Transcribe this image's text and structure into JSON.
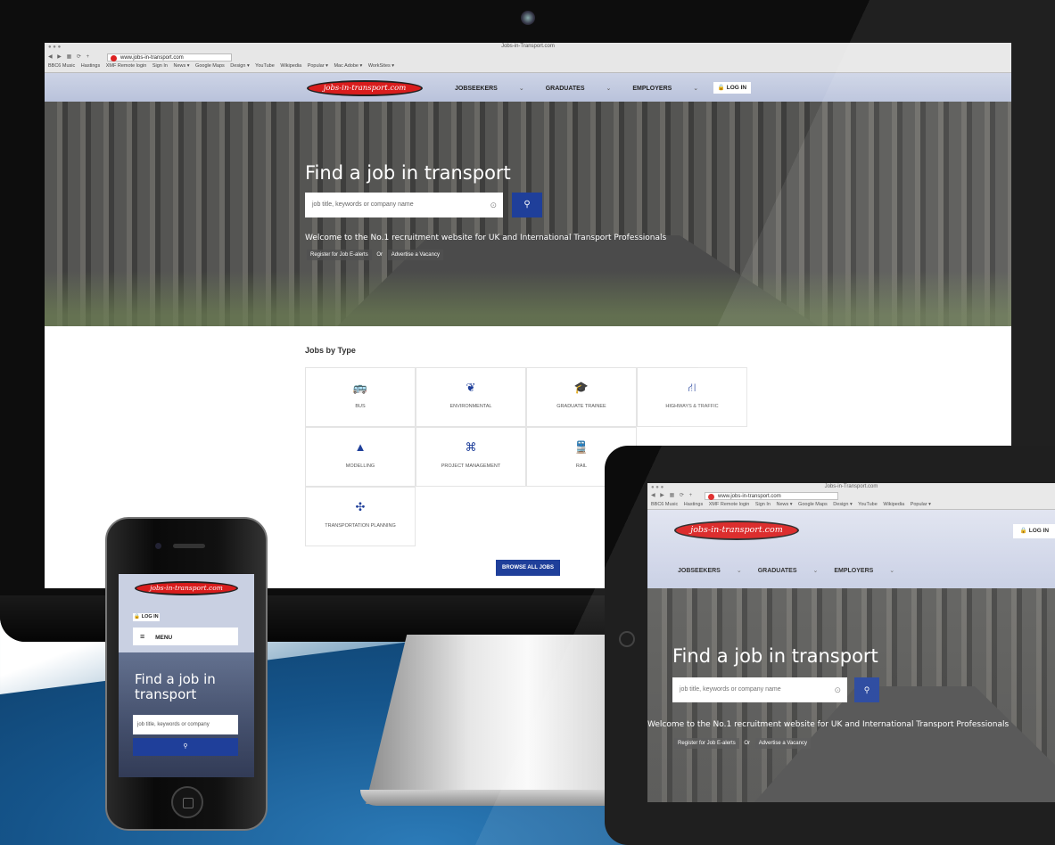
{
  "colors": {
    "brand_blue": "#1f3f9a",
    "logo_red": "#d91c1c"
  },
  "browser": {
    "title": "Jobs-in-Transport.com",
    "url": "www.jobs-in-transport.com",
    "nav_buttons": "◀ ▶ ▦ ⟳ +",
    "bookmarks": [
      "BBC6 Music",
      "Hastings",
      "XMF Remote login",
      "Sign In",
      "News ▾",
      "Google Maps",
      "Design ▾",
      "YouTube",
      "Wikipedia",
      "Popular ▾",
      "Mac Adobe ▾",
      "WorkSites ▾"
    ]
  },
  "site": {
    "logo_text": "jobs-in-transport.com",
    "nav": [
      "JOBSEEKERS",
      "GRADUATES",
      "EMPLOYERS"
    ],
    "login": "🔒 LOG IN",
    "hero_title": "Find a job in transport",
    "search_placeholder": "job title, keywords or company name",
    "search_icon": "magnifier-icon",
    "welcome": "Welcome to the No.1 recruitment website for UK and International Transport Professionals",
    "register_link": "Register for Job E-alerts",
    "or": "Or",
    "advertise_link": "Advertise a Vacancy",
    "jobs_by_type_title": "Jobs by Type",
    "job_types": [
      {
        "label": "BUS",
        "icon": "🚌"
      },
      {
        "label": "ENVIRONMENTAL",
        "icon": "❦"
      },
      {
        "label": "GRADUATE TRAINEE",
        "icon": "🎓"
      },
      {
        "label": "HIGHWAYS & TRAFFIC",
        "icon": "⛙"
      },
      {
        "label": "MODELLING",
        "icon": "▲"
      },
      {
        "label": "PROJECT MANAGEMENT",
        "icon": "⌘"
      },
      {
        "label": "RAIL",
        "icon": "🚆"
      },
      {
        "label": "TRANSPORTATION PLANNING",
        "icon": "✣"
      }
    ],
    "browse_all": "BROWSE ALL JOBS"
  },
  "phone": {
    "login": "🔒 LOG IN",
    "menu": "MENU",
    "hero_title": "Find a job in transport",
    "search_placeholder": "job title, keywords or company"
  }
}
